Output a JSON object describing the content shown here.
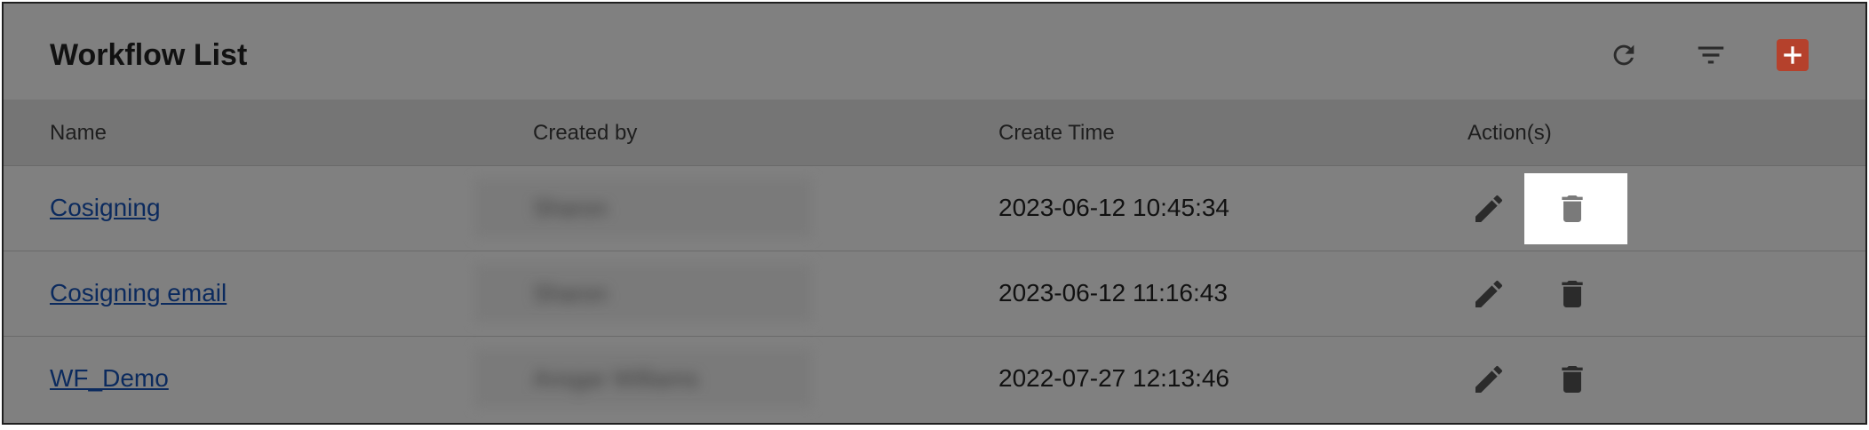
{
  "header": {
    "title": "Workflow List",
    "refresh_icon": "refresh-icon",
    "filter_icon": "filter-icon",
    "add_icon": "plus-icon"
  },
  "columns": {
    "name": "Name",
    "created_by": "Created by",
    "create_time": "Create Time",
    "actions": "Action(s)"
  },
  "rows": [
    {
      "name": "Cosigning",
      "created_by": "Sharon",
      "create_time": "2023-06-12 10:45:34"
    },
    {
      "name": "Cosigning email",
      "created_by": "Sharon",
      "create_time": "2023-06-12 11:16:43"
    },
    {
      "name": "WF_Demo",
      "created_by": "Ansgar Williams",
      "create_time": "2022-07-27 12:13:46"
    }
  ],
  "actions": {
    "edit_icon": "pencil-icon",
    "delete_icon": "trash-icon"
  },
  "colors": {
    "overlay": "#808080",
    "accent": "#b5412c",
    "link": "#0b2a5e",
    "highlight": "#ffffff"
  }
}
